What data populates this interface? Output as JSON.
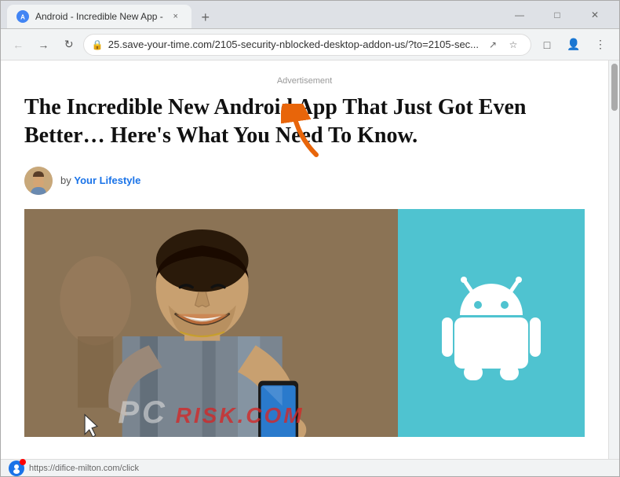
{
  "browser": {
    "tab": {
      "favicon_label": "A",
      "title": "Android - Incredible New App -",
      "close_label": "×"
    },
    "new_tab_label": "+",
    "window_controls": {
      "minimize": "—",
      "maximize": "□",
      "close": "✕"
    },
    "toolbar": {
      "back_label": "←",
      "forward_label": "→",
      "reload_label": "↻",
      "url": "25.save-your-time.com/2105-security-nblocked-desktop-addon-us/?to=2105-sec...",
      "share_label": "↗",
      "bookmark_label": "☆",
      "extensions_label": "□",
      "profile_label": "👤",
      "menu_label": "⋮"
    },
    "status_bar": {
      "url": "https://difice-milton.com/click"
    }
  },
  "page": {
    "advertisement_label": "Advertisement",
    "title": "The Incredible New Android App That Just Got Even Better… Here's What You Need To Know.",
    "author_prefix": "by",
    "author_name": "Your Lifestyle",
    "watermark": "RISK.COM",
    "android_panel_color": "#4fc3d0"
  }
}
